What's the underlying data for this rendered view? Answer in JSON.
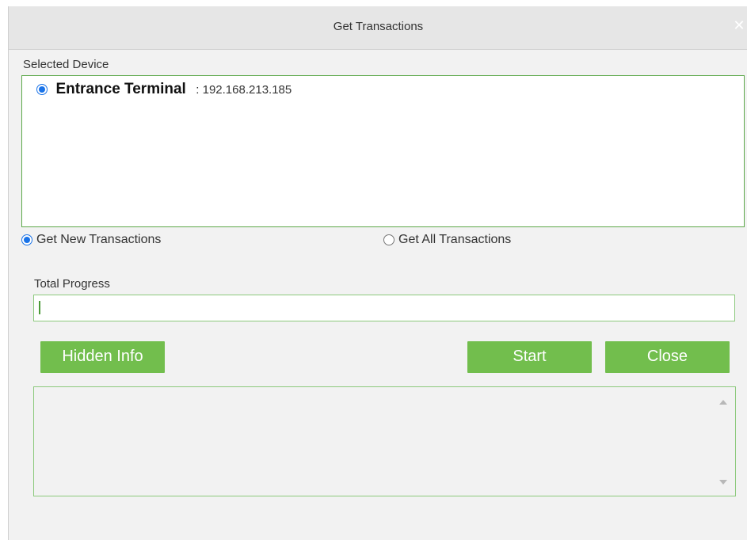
{
  "dialog": {
    "title": "Get Transactions",
    "close_icon": "close-icon"
  },
  "selected_device": {
    "label": "Selected Device",
    "devices": [
      {
        "name": "Entrance Terminal",
        "ip": ": 192.168.213.185",
        "selected": true
      }
    ]
  },
  "options": {
    "new_label": "Get New Transactions",
    "all_label": "Get All Transactions",
    "selected": "new"
  },
  "progress": {
    "label": "Total Progress",
    "value_fraction": 0.002
  },
  "buttons": {
    "hidden_info": "Hidden Info",
    "start": "Start",
    "close": "Close"
  },
  "colors": {
    "accent_green": "#72be4d",
    "border_green": "#5ca84a",
    "radio_blue": "#1a73e8"
  }
}
